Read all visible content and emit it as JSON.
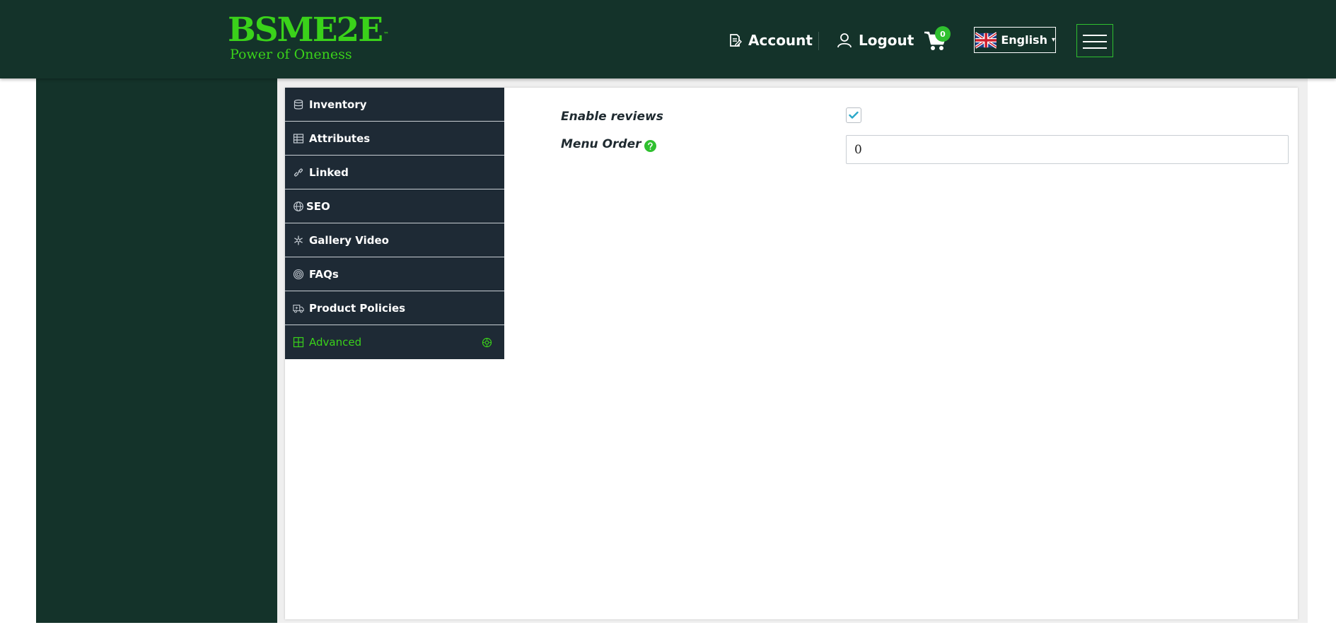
{
  "header": {
    "logo": {
      "name": "BSME2E",
      "tm": "™",
      "tagline": "Power of Oneness"
    },
    "account_label": "Account",
    "logout_label": "Logout",
    "cart_count": "0",
    "language": {
      "selected": "English",
      "caret": "▾",
      "flag_icon": "uk-flag-icon"
    },
    "menu_icon": "hamburger-icon"
  },
  "tabs": [
    {
      "label": "Inventory",
      "icon": "database-icon",
      "active": false
    },
    {
      "label": "Attributes",
      "icon": "table-icon",
      "active": false
    },
    {
      "label": "Linked",
      "icon": "link-icon",
      "active": false
    },
    {
      "label": "SEO",
      "icon": "globe-icon",
      "active": false
    },
    {
      "label": "Gallery Video",
      "icon": "snowflake-icon",
      "active": false
    },
    {
      "label": "FAQs",
      "icon": "concentric-circles-icon",
      "active": false
    },
    {
      "label": "Product Policies",
      "icon": "truck-icon",
      "active": false
    },
    {
      "label": "Advanced",
      "icon": "grid-icon",
      "active": true
    }
  ],
  "form": {
    "enable_reviews": {
      "label": "Enable reviews",
      "checked": true
    },
    "menu_order": {
      "label": "Menu Order",
      "value": "0",
      "help_icon": "help-icon"
    }
  },
  "colors": {
    "header_bg": "#14332a",
    "accent_green": "#3ad21a",
    "tab_bg": "#1e2a35",
    "checkbox_check": "#2aa8c9"
  }
}
